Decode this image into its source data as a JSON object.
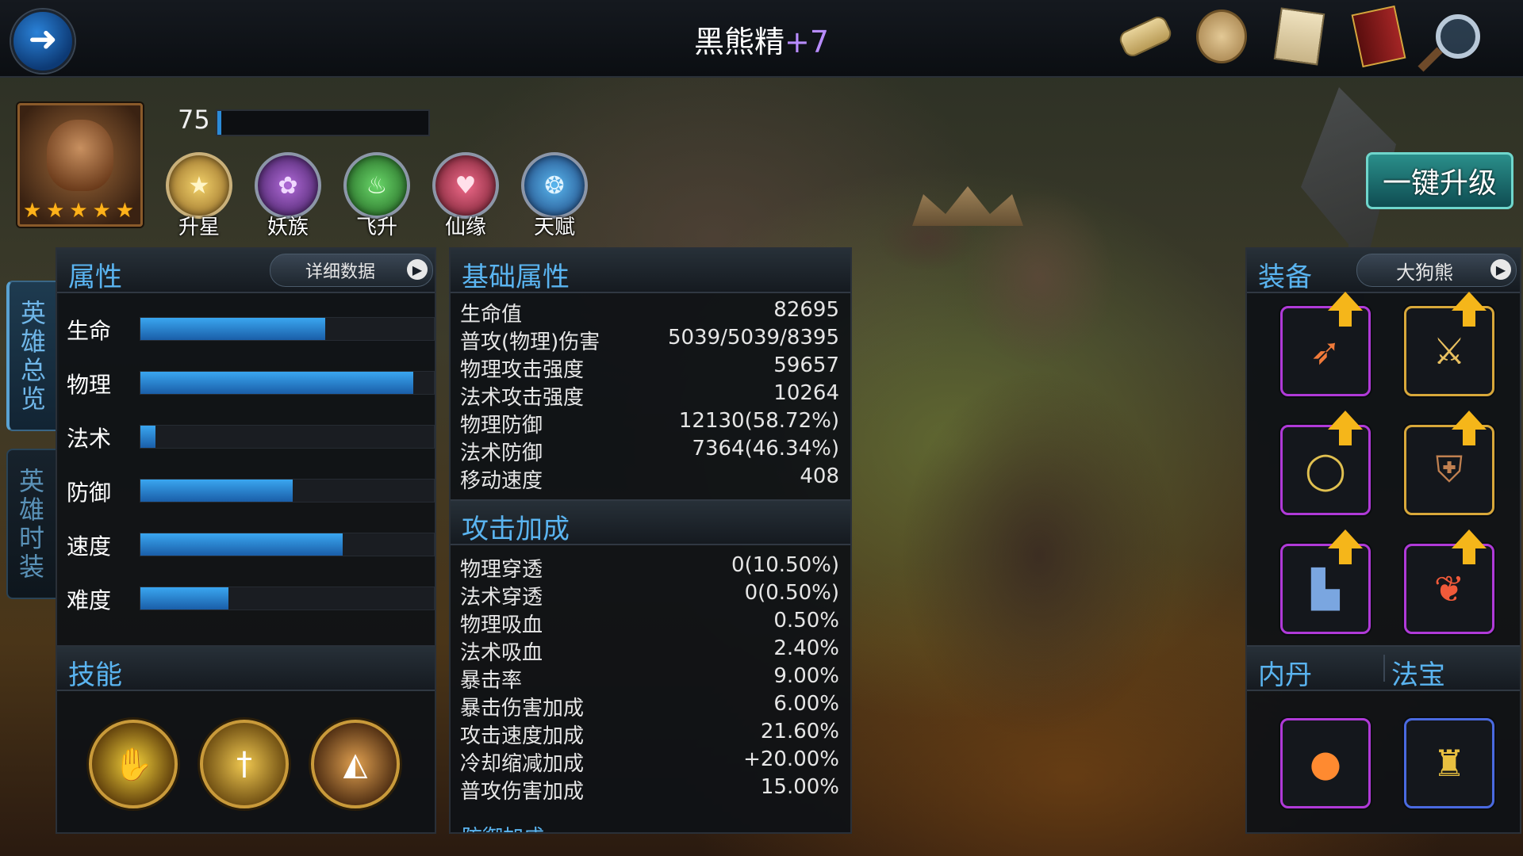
{
  "header": {
    "title": "黑熊精",
    "title_plus": "+7",
    "back_icon": "back-arrow-icon",
    "top_icons": [
      "scroll-icon",
      "coin-icon",
      "paper-icon",
      "book-icon",
      "magnifier-icon"
    ]
  },
  "hero": {
    "level": "75",
    "exp_fill": 0.02,
    "stars": [
      "★",
      "★",
      "★",
      "★",
      "★"
    ]
  },
  "functions": [
    {
      "label": "升星",
      "icon": "star-icon"
    },
    {
      "label": "妖族",
      "icon": "demon-icon"
    },
    {
      "label": "飞升",
      "icon": "flame-icon"
    },
    {
      "label": "仙缘",
      "icon": "heart-icon"
    },
    {
      "label": "天赋",
      "icon": "talent-icon"
    }
  ],
  "side_tabs": [
    {
      "chars": [
        "英",
        "雄",
        "总",
        "览"
      ],
      "active": true
    },
    {
      "chars": [
        "英",
        "雄",
        "时",
        "装"
      ],
      "active": false
    }
  ],
  "attributes": {
    "title": "属性",
    "detail_button": "详细数据",
    "rows": [
      {
        "label": "生命",
        "fill": 0.63
      },
      {
        "label": "物理",
        "fill": 0.93
      },
      {
        "label": "法术",
        "fill": 0.05
      },
      {
        "label": "防御",
        "fill": 0.52
      },
      {
        "label": "速度",
        "fill": 0.69
      },
      {
        "label": "难度",
        "fill": 0.3
      }
    ]
  },
  "skills": {
    "title": "技能",
    "icons": [
      "claw-icon",
      "sword-icon",
      "axe-icon"
    ]
  },
  "base_stats": {
    "title": "基础属性",
    "rows": [
      {
        "label": "生命值",
        "value": "82695"
      },
      {
        "label": "普攻(物理)伤害",
        "value": "5039/5039/8395"
      },
      {
        "label": "物理攻击强度",
        "value": "59657"
      },
      {
        "label": "法术攻击强度",
        "value": "10264"
      },
      {
        "label": "物理防御",
        "value": "12130(58.72%)"
      },
      {
        "label": "法术防御",
        "value": "7364(46.34%)"
      },
      {
        "label": "移动速度",
        "value": "408"
      }
    ]
  },
  "attack_bonus": {
    "title": "攻击加成",
    "rows": [
      {
        "label": "物理穿透",
        "value": "0(10.50%)"
      },
      {
        "label": "法术穿透",
        "value": "0(0.50%)"
      },
      {
        "label": "物理吸血",
        "value": "0.50%"
      },
      {
        "label": "法术吸血",
        "value": "2.40%"
      },
      {
        "label": "暴击率",
        "value": "9.00%"
      },
      {
        "label": "暴击伤害加成",
        "value": "6.00%"
      },
      {
        "label": "攻击速度加成",
        "value": "21.60%"
      },
      {
        "label": "冷却缩减加成",
        "value": "+20.00%"
      },
      {
        "label": "普攻伤害加成",
        "value": "15.00%"
      }
    ],
    "next_title_partial": "防御加成"
  },
  "upgrade_button": "一键升级",
  "equipment": {
    "title": "装备",
    "preset": "大狗熊",
    "slots": [
      {
        "icon": "spear-icon",
        "frame": "purple",
        "upgradable": true
      },
      {
        "icon": "axe-icon",
        "frame": "gold",
        "upgradable": true
      },
      {
        "icon": "ring-icon",
        "frame": "purple",
        "upgradable": true
      },
      {
        "icon": "armor-icon",
        "frame": "gold",
        "upgradable": true
      },
      {
        "icon": "boots-icon",
        "frame": "purple",
        "upgradable": true
      },
      {
        "icon": "phoenix-icon",
        "frame": "purple",
        "upgradable": true
      }
    ],
    "inner_core_title": "内丹",
    "treasure_title": "法宝",
    "inner_core_icon": "fire-orb-icon",
    "treasure_icon": "golden-bell-icon"
  }
}
